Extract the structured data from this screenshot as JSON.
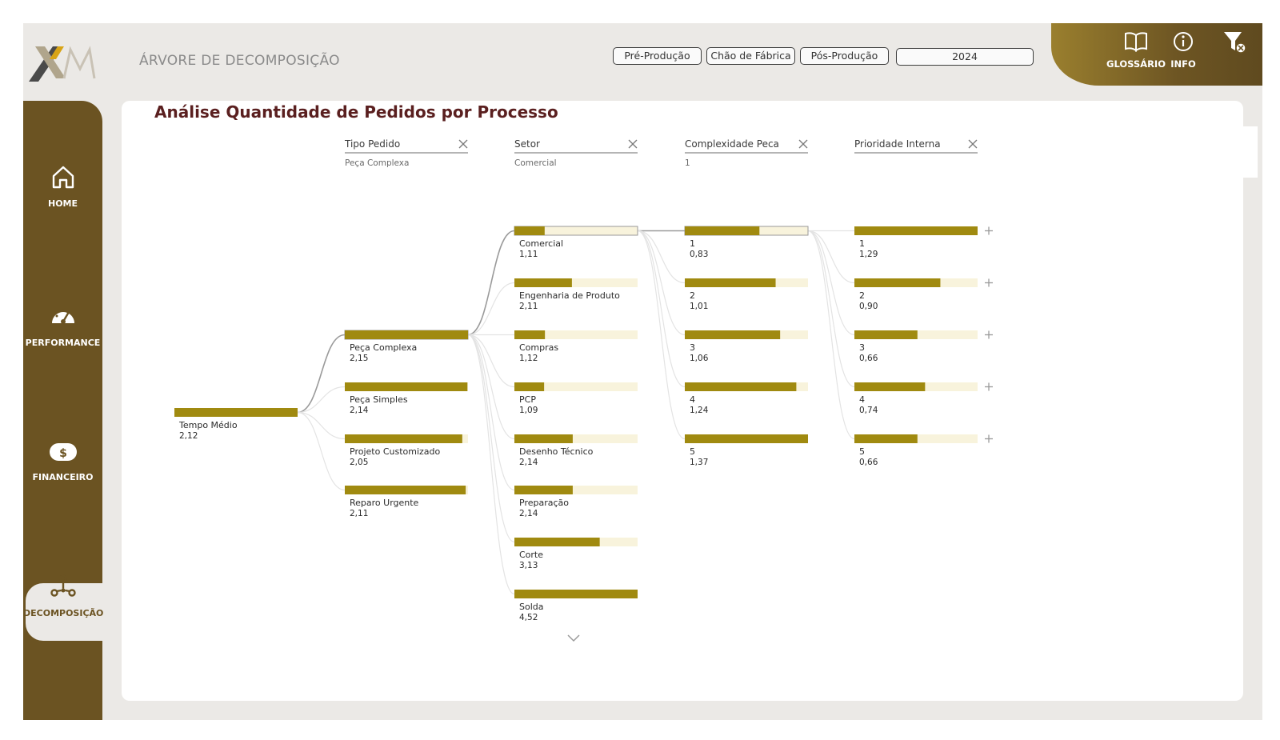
{
  "header": {
    "title": "ÁRVORE DE  DECOMPOSIÇÃO",
    "buttons": [
      "Pré-Produção",
      "Chão de Fábrica",
      "Pós-Produção"
    ],
    "year": "2024",
    "glossary_label": "GLOSSÁRIO",
    "info_label": "INFO"
  },
  "sidebar": {
    "items": [
      {
        "label": "HOME",
        "icon": "home-icon"
      },
      {
        "label": "PERFORMANCE",
        "icon": "gauge-icon"
      },
      {
        "label": "FINANCEIRO",
        "icon": "dollar-icon"
      },
      {
        "label": "DECOMPOSIÇÃO",
        "icon": "decomposition-icon",
        "active": true
      }
    ]
  },
  "main": {
    "title": "Análise Quantidade de Pedidos por Processo"
  },
  "colors": {
    "bar": "#a08a10",
    "bar_bg": "#f8f3dc",
    "brand": "#6b5322",
    "title": "#5a1f1f"
  },
  "chart_data": {
    "type": "decomposition-tree",
    "scale_max": 4.52,
    "root": {
      "label": "Tempo Médio",
      "value": 2.12,
      "value_text": "2,12"
    },
    "levels": [
      {
        "header": "Tipo Pedido",
        "selected": "Peça Complexa",
        "bar_max": 2.15,
        "nodes": [
          {
            "label": "Peça Complexa",
            "value": 2.15,
            "value_text": "2,15",
            "selected": true
          },
          {
            "label": "Peça Simples",
            "value": 2.14,
            "value_text": "2,14"
          },
          {
            "label": "Projeto Customizado",
            "value": 2.05,
            "value_text": "2,05"
          },
          {
            "label": "Reparo Urgente",
            "value": 2.11,
            "value_text": "2,11"
          }
        ]
      },
      {
        "header": "Setor",
        "selected": "Comercial",
        "bar_max": 4.52,
        "nodes": [
          {
            "label": "Comercial",
            "value": 1.11,
            "value_text": "1,11",
            "selected": true
          },
          {
            "label": "Engenharia de Produto",
            "value": 2.11,
            "value_text": "2,11"
          },
          {
            "label": "Compras",
            "value": 1.12,
            "value_text": "1,12"
          },
          {
            "label": "PCP",
            "value": 1.09,
            "value_text": "1,09"
          },
          {
            "label": "Desenho Técnico",
            "value": 2.14,
            "value_text": "2,14"
          },
          {
            "label": "Preparação",
            "value": 2.14,
            "value_text": "2,14"
          },
          {
            "label": "Corte",
            "value": 3.13,
            "value_text": "3,13"
          },
          {
            "label": "Solda",
            "value": 4.52,
            "value_text": "4,52"
          }
        ]
      },
      {
        "header": "Complexidade Peca",
        "selected": "1",
        "bar_max": 1.37,
        "nodes": [
          {
            "label": "1",
            "value": 0.83,
            "value_text": "0,83",
            "selected": true
          },
          {
            "label": "2",
            "value": 1.01,
            "value_text": "1,01"
          },
          {
            "label": "3",
            "value": 1.06,
            "value_text": "1,06"
          },
          {
            "label": "4",
            "value": 1.24,
            "value_text": "1,24"
          },
          {
            "label": "5",
            "value": 1.37,
            "value_text": "1,37"
          }
        ]
      },
      {
        "header": "Prioridade Interna",
        "selected": "",
        "bar_max": 1.29,
        "nodes": [
          {
            "label": "1",
            "value": 1.29,
            "value_text": "1,29"
          },
          {
            "label": "2",
            "value": 0.9,
            "value_text": "0,90"
          },
          {
            "label": "3",
            "value": 0.66,
            "value_text": "0,66"
          },
          {
            "label": "4",
            "value": 0.74,
            "value_text": "0,74"
          },
          {
            "label": "5",
            "value": 0.66,
            "value_text": "0,66"
          }
        ]
      }
    ]
  }
}
